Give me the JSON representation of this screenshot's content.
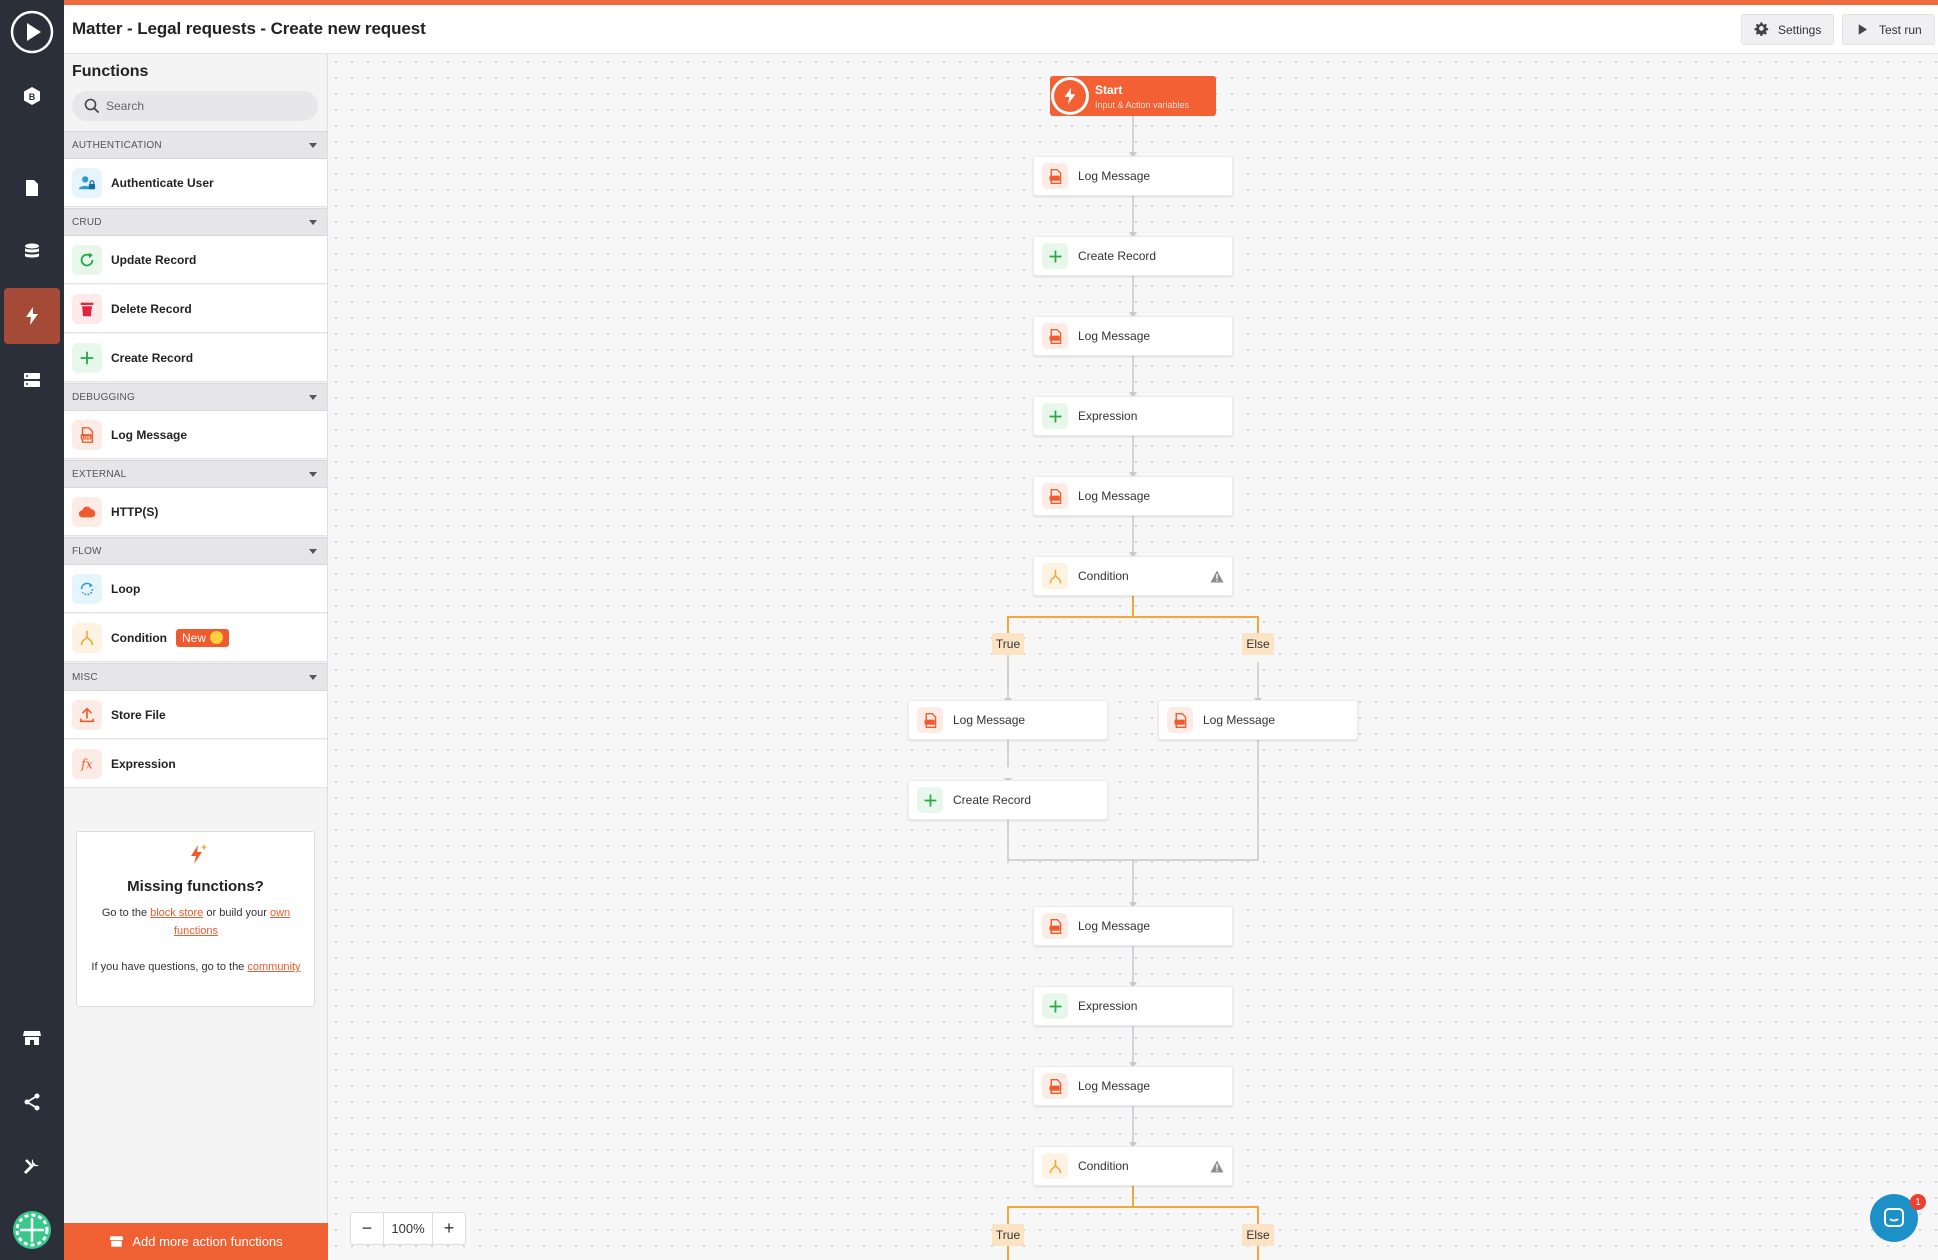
{
  "header": {
    "title": "Matter - Legal requests - Create new request",
    "settings_label": "Settings",
    "test_run_label": "Test run"
  },
  "rail": {
    "items": [
      "play-logo-icon",
      "b-badge-icon",
      "file-icon",
      "database-icon",
      "lightning-icon",
      "server-icon",
      "store-icon",
      "share-icon",
      "tools-icon",
      "user-avatar"
    ],
    "active": "lightning-icon"
  },
  "panel": {
    "title": "Functions",
    "search_placeholder": "Search",
    "categories": [
      {
        "name": "AUTHENTICATION",
        "items": [
          {
            "label": "Authenticate User",
            "icon": "user-lock-icon"
          }
        ]
      },
      {
        "name": "CRUD",
        "items": [
          {
            "label": "Update Record",
            "icon": "refresh-icon"
          },
          {
            "label": "Delete Record",
            "icon": "trash-icon"
          },
          {
            "label": "Create Record",
            "icon": "plus-icon"
          }
        ]
      },
      {
        "name": "DEBUGGING",
        "items": [
          {
            "label": "Log Message",
            "icon": "log-icon"
          }
        ]
      },
      {
        "name": "EXTERNAL",
        "items": [
          {
            "label": "HTTP(S)",
            "icon": "cloud-icon"
          }
        ]
      },
      {
        "name": "FLOW",
        "items": [
          {
            "label": "Loop",
            "icon": "loop-icon"
          },
          {
            "label": "Condition",
            "icon": "condition-icon",
            "badge": "New"
          }
        ]
      },
      {
        "name": "MISC",
        "items": [
          {
            "label": "Store File",
            "icon": "upload-icon"
          },
          {
            "label": "Expression",
            "icon": "fx-icon"
          }
        ]
      }
    ],
    "missing": {
      "title": "Missing functions?",
      "line1_prefix": "Go to the ",
      "block_store_link": "block store",
      "line1_mid": " or build your ",
      "own_functions_link": "own functions",
      "line2_prefix": "If you have questions, go to the ",
      "community_link": "community"
    },
    "add_more_label": "Add more action functions"
  },
  "canvas": {
    "start": {
      "title": "Start",
      "subtitle": "Input & Action variables"
    },
    "nodes": [
      "Log Message",
      "Create Record",
      "Log Message",
      "Expression",
      "Log Message",
      "Condition",
      "Log Message",
      "Create Record",
      "Log Message",
      "Log Message",
      "Expression",
      "Log Message",
      "Condition"
    ],
    "branch_true": "True",
    "branch_else": "Else",
    "zoom": "100%"
  },
  "colors": {
    "accent": "#ef6133",
    "rail": "#2b2f3a",
    "rail_active": "#a54a36",
    "branch_line": "#f0a83a",
    "chat": "#1e90c8"
  },
  "chat_badge": "1"
}
